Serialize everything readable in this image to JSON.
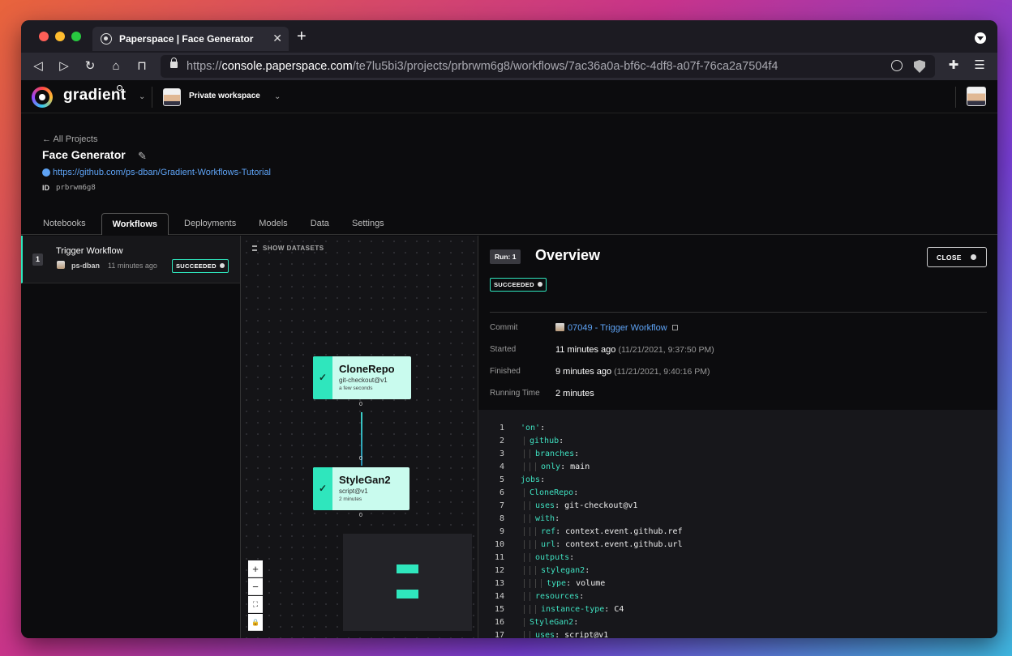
{
  "browser": {
    "tab_title": "Paperspace | Face Generator",
    "url_scheme": "https://",
    "url_host": "console.paperspace.com",
    "url_path": "/te7lu5bi3/projects/prbrwm6g8/workflows/7ac36a0a-bf6c-4df8-a07f-76ca2a7504f4"
  },
  "app": {
    "brand": "gradient",
    "workspace": "Private workspace"
  },
  "project": {
    "back_label": "← All Projects",
    "title": "Face Generator",
    "repo_url": "https://github.com/ps-dban/Gradient-Workflows-Tutorial",
    "id_label": "ID",
    "id_value": "prbrwm6g8",
    "tabs": [
      {
        "label": "Notebooks"
      },
      {
        "label": "Workflows"
      },
      {
        "label": "Deployments"
      },
      {
        "label": "Models"
      },
      {
        "label": "Data"
      },
      {
        "label": "Settings"
      }
    ]
  },
  "runs": [
    {
      "num": "1",
      "title": "Trigger Workflow",
      "user": "ps-dban",
      "time": "11 minutes ago",
      "status": "SUCCEEDED"
    }
  ],
  "canvas": {
    "show_datasets": "SHOW DATASETS",
    "nodes": [
      {
        "name": "CloneRepo",
        "action": "git-checkout@v1",
        "time": "a few seconds",
        "in_port": "",
        "out_port": "0"
      },
      {
        "name": "StyleGan2",
        "action": "script@v1",
        "time": "2 minutes",
        "in_port": "0",
        "out_port": "0"
      }
    ],
    "controls": [
      "+",
      "−",
      "⛶",
      "🔒"
    ]
  },
  "overview": {
    "run_chip": "Run: 1",
    "title": "Overview",
    "close_label": "CLOSE",
    "status": "SUCCEEDED",
    "commit_label": "Commit",
    "commit_value": "07049 - Trigger Workflow",
    "started_label": "Started",
    "started_value": "11 minutes ago",
    "started_sub": "(11/21/2021, 9:37:50 PM)",
    "finished_label": "Finished",
    "finished_value": "9 minutes ago",
    "finished_sub": "(11/21/2021, 9:40:16 PM)",
    "running_label": "Running Time",
    "running_value": "2 minutes"
  },
  "code_lines": [
    {
      "n": "1",
      "indent": 0,
      "key": "'on'",
      "val": ""
    },
    {
      "n": "2",
      "indent": 1,
      "key": "github",
      "val": ""
    },
    {
      "n": "3",
      "indent": 2,
      "key": "branches",
      "val": ""
    },
    {
      "n": "4",
      "indent": 3,
      "key": "only",
      "val": " main"
    },
    {
      "n": "5",
      "indent": 0,
      "key": "jobs",
      "val": ""
    },
    {
      "n": "6",
      "indent": 1,
      "key": "CloneRepo",
      "val": ""
    },
    {
      "n": "7",
      "indent": 2,
      "key": "uses",
      "val": " git-checkout@v1"
    },
    {
      "n": "8",
      "indent": 2,
      "key": "with",
      "val": ""
    },
    {
      "n": "9",
      "indent": 3,
      "key": "ref",
      "val": " context.event.github.ref"
    },
    {
      "n": "10",
      "indent": 3,
      "key": "url",
      "val": " context.event.github.url"
    },
    {
      "n": "11",
      "indent": 2,
      "key": "outputs",
      "val": ""
    },
    {
      "n": "12",
      "indent": 3,
      "key": "stylegan2",
      "val": ""
    },
    {
      "n": "13",
      "indent": 4,
      "key": "type",
      "val": " volume"
    },
    {
      "n": "14",
      "indent": 2,
      "key": "resources",
      "val": ""
    },
    {
      "n": "15",
      "indent": 3,
      "key": "instance-type",
      "val": " C4"
    },
    {
      "n": "16",
      "indent": 1,
      "key": "StyleGan2",
      "val": ""
    },
    {
      "n": "17",
      "indent": 2,
      "key": "uses",
      "val": " script@v1"
    }
  ],
  "colors": {
    "accent": "#2fe6bd",
    "link": "#5ea3f5",
    "node_bg": "#c9fbee"
  }
}
